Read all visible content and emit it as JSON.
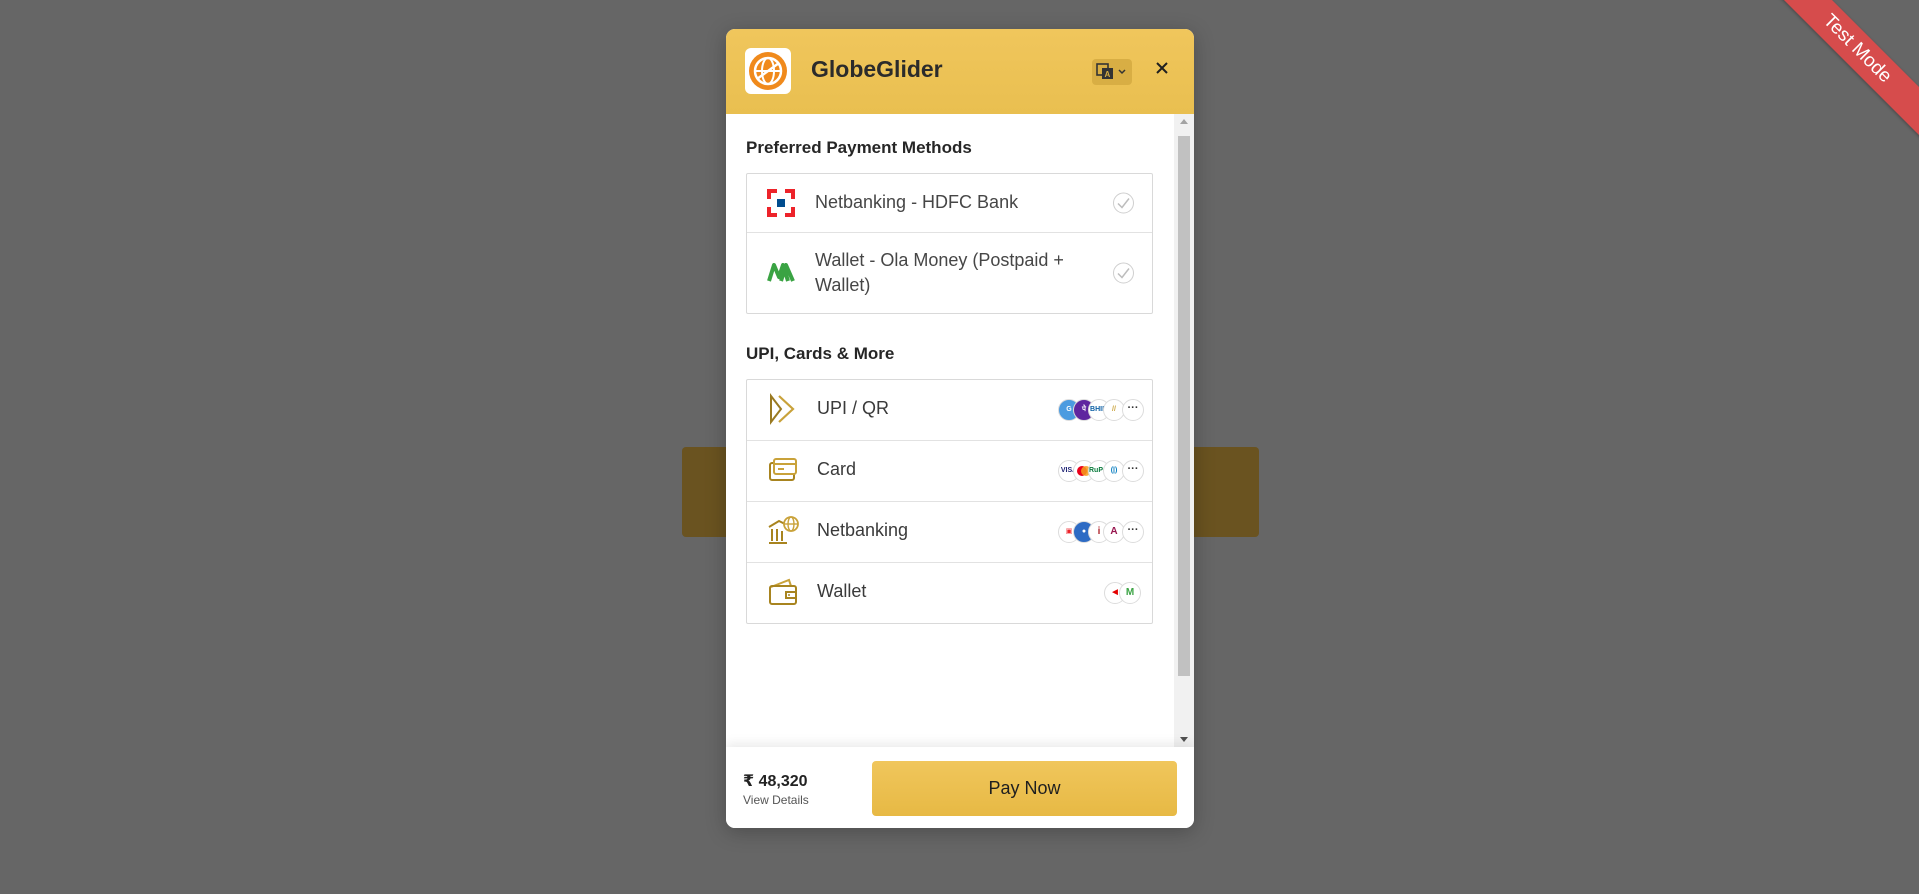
{
  "ribbon": {
    "label": "Test Mode"
  },
  "header": {
    "brand": "GlobeGlider",
    "logo_icon": "globe-logo-icon",
    "language_icon": "translate-icon",
    "close_icon": "close-icon",
    "accent_color": "#f0c65c"
  },
  "preferred": {
    "title": "Preferred Payment Methods",
    "items": [
      {
        "label": "Netbanking - HDFC Bank",
        "icon": "hdfc-bank-icon"
      },
      {
        "label": "Wallet - Ola Money (Postpaid + Wallet)",
        "icon": "ola-money-icon"
      }
    ]
  },
  "methods": {
    "title": "UPI, Cards & More",
    "items": [
      {
        "label": "UPI / QR",
        "icon": "upi-icon",
        "badges": [
          "gpay",
          "phonepe",
          "bhim",
          "paytm",
          "more"
        ]
      },
      {
        "label": "Card",
        "icon": "card-icon",
        "badges": [
          "visa",
          "mastercard",
          "rupay",
          "diners",
          "more"
        ]
      },
      {
        "label": "Netbanking",
        "icon": "bank-icon",
        "badges": [
          "hdfc",
          "sbi",
          "icici",
          "axis",
          "more"
        ]
      },
      {
        "label": "Wallet",
        "icon": "wallet-icon",
        "badges": [
          "airtel",
          "ola"
        ]
      }
    ]
  },
  "footer": {
    "amount": "₹ 48,320",
    "view_details": "View Details",
    "pay_button": "Pay Now"
  }
}
